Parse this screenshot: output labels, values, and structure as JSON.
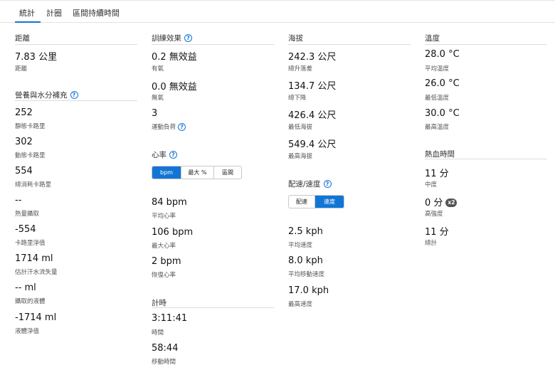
{
  "tabs": [
    {
      "label": "統計"
    },
    {
      "label": "計圈"
    },
    {
      "label": "區間持續時間"
    }
  ],
  "distance": {
    "title": "距離",
    "value": "7.83 公里",
    "label": "距離"
  },
  "nutrition": {
    "title": "營養與水分補充",
    "items": [
      {
        "value": "252",
        "label": "靜態卡路里"
      },
      {
        "value": "302",
        "label": "動態卡路里"
      },
      {
        "value": "554",
        "label": "總消耗卡路里"
      },
      {
        "value": "--",
        "label": "熱量攝取"
      },
      {
        "value": "-554",
        "label": "卡路里淨值"
      },
      {
        "value": "1714 ml",
        "label": "估計汗水流失量"
      },
      {
        "value": "-- ml",
        "label": "攝取的液體"
      },
      {
        "value": "-1714 ml",
        "label": "液體淨值"
      }
    ]
  },
  "training_effect": {
    "title": "訓練效果",
    "items": [
      {
        "value": "0.2 無效益",
        "label": "有氧"
      },
      {
        "value": "0.0 無效益",
        "label": "無氧"
      },
      {
        "value": "3",
        "label": "運動負荷"
      }
    ]
  },
  "heart_rate": {
    "title": "心率",
    "toggle": [
      "bpm",
      "最大 %",
      "區間"
    ],
    "selected": "bpm",
    "items": [
      {
        "value": "84 bpm",
        "label": "平均心率"
      },
      {
        "value": "106 bpm",
        "label": "最大心率"
      },
      {
        "value": "2 bpm",
        "label": "恢復心率"
      }
    ]
  },
  "timing": {
    "title": "計時",
    "items": [
      {
        "value": "3:11:41",
        "label": "時間"
      },
      {
        "value": "58:44",
        "label": "移動時間"
      }
    ]
  },
  "elevation": {
    "title": "海拔",
    "items": [
      {
        "value": "242.3 公尺",
        "label": "總升落差"
      },
      {
        "value": "134.7 公尺",
        "label": "總下降"
      },
      {
        "value": "426.4 公尺",
        "label": "最低海拔"
      },
      {
        "value": "549.4 公尺",
        "label": "最高海拔"
      }
    ]
  },
  "pace_speed": {
    "title": "配速/速度",
    "toggle": [
      "配速",
      "速度"
    ],
    "selected": "速度",
    "items": [
      {
        "value": "2.5 kph",
        "label": "平均速度"
      },
      {
        "value": "8.0 kph",
        "label": "平均移動速度"
      },
      {
        "value": "17.0 kph",
        "label": "最高速度"
      }
    ]
  },
  "temperature": {
    "title": "溫度",
    "items": [
      {
        "value": "28.0 °C",
        "label": "平均溫度"
      },
      {
        "value": "26.0 °C",
        "label": "最低溫度"
      },
      {
        "value": "30.0 °C",
        "label": "最高溫度"
      }
    ]
  },
  "heat_time": {
    "title": "熱血時間",
    "badge": "x2",
    "items": [
      {
        "value": "11 分",
        "label": "中度"
      },
      {
        "value": "0 分",
        "label": "高強度"
      },
      {
        "value": "11 分",
        "label": "總計"
      }
    ]
  }
}
